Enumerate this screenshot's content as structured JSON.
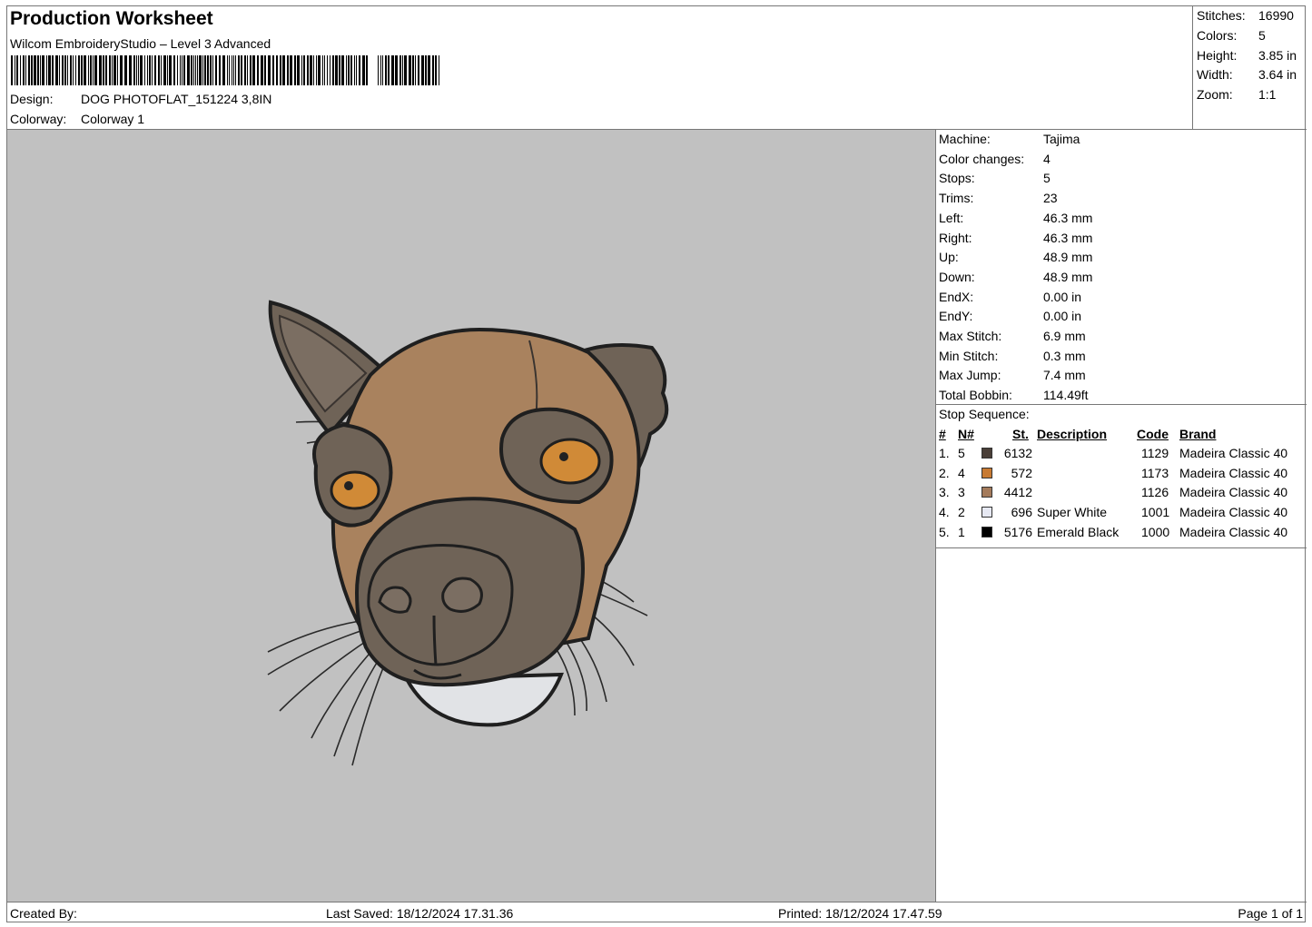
{
  "header": {
    "title": "Production Worksheet",
    "subtitle": "Wilcom EmbroideryStudio – Level 3 Advanced",
    "design_label": "Design:",
    "design_value": "DOG PHOTOFLAT_151224 3,8IN",
    "colorway_label": "Colorway:",
    "colorway_value": "Colorway 1"
  },
  "summary": [
    {
      "label": "Stitches:",
      "value": "16990"
    },
    {
      "label": "Colors:",
      "value": "5"
    },
    {
      "label": "Height:",
      "value": "3.85 in"
    },
    {
      "label": "Width:",
      "value": "3.64 in"
    },
    {
      "label": "Zoom:",
      "value": "1:1"
    }
  ],
  "machine_info": [
    {
      "label": "Machine:",
      "value": "Tajima"
    },
    {
      "label": "Color changes:",
      "value": "4"
    },
    {
      "label": "Stops:",
      "value": "5"
    },
    {
      "label": "Trims:",
      "value": "23"
    },
    {
      "label": "Left:",
      "value": "46.3 mm"
    },
    {
      "label": "Right:",
      "value": "46.3 mm"
    },
    {
      "label": "Up:",
      "value": "48.9 mm"
    },
    {
      "label": "Down:",
      "value": "48.9 mm"
    },
    {
      "label": "EndX:",
      "value": "0.00 in"
    },
    {
      "label": "EndY:",
      "value": "0.00 in"
    },
    {
      "label": "Max Stitch:",
      "value": "6.9 mm"
    },
    {
      "label": "Min Stitch:",
      "value": "0.3 mm"
    },
    {
      "label": "Max Jump:",
      "value": "7.4 mm"
    },
    {
      "label": "Total Bobbin:",
      "value": "114.49ft"
    }
  ],
  "stop_sequence": {
    "title": "Stop Sequence:",
    "headers": {
      "num": "#",
      "n": "N#",
      "st": "St.",
      "desc": "Description",
      "code": "Code",
      "brand": "Brand"
    },
    "rows": [
      {
        "num": "1.",
        "n": "5",
        "color": "#4a3f38",
        "st": "6132",
        "desc": "",
        "code": "1129",
        "brand": "Madeira Classic 40"
      },
      {
        "num": "2.",
        "n": "4",
        "color": "#c77a33",
        "st": "572",
        "desc": "",
        "code": "1173",
        "brand": "Madeira Classic 40"
      },
      {
        "num": "3.",
        "n": "3",
        "color": "#a47b5c",
        "st": "4412",
        "desc": "",
        "code": "1126",
        "brand": "Madeira Classic 40"
      },
      {
        "num": "4.",
        "n": "2",
        "color": "#e6e8f2",
        "st": "696",
        "desc": "Super White",
        "code": "1001",
        "brand": "Madeira Classic 40"
      },
      {
        "num": "5.",
        "n": "1",
        "color": "#000000",
        "st": "5176",
        "desc": "Emerald Black",
        "code": "1000",
        "brand": "Madeira Classic 40"
      }
    ]
  },
  "footer": {
    "created_by": "Created By:",
    "last_saved": "Last Saved: 18/12/2024 17.31.36",
    "printed": "Printed: 18/12/2024 17.47.59",
    "page": "Page 1 of 1"
  },
  "colors": {
    "canvas_bg": "#c1c1c1",
    "fur_tan": "#a9825e",
    "mask_dark": "#6f6357",
    "eye_orange": "#d08a37",
    "mouth_white": "#e1e3e6",
    "outline": "#1f1f1f"
  }
}
